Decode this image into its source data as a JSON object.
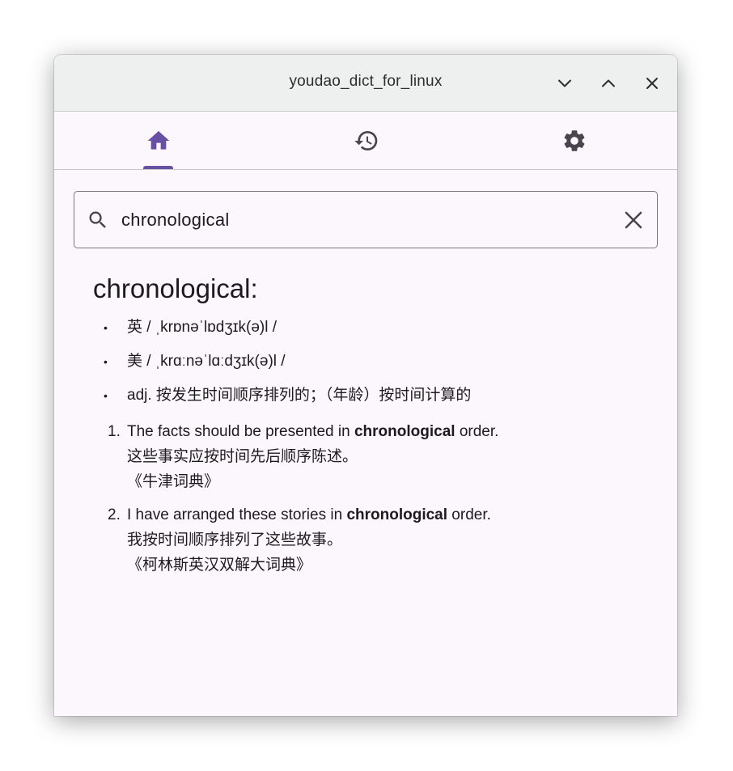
{
  "window": {
    "title": "youdao_dict_for_linux"
  },
  "nav": {
    "tabs": [
      {
        "name": "home",
        "icon": "home-icon",
        "active": true
      },
      {
        "name": "history",
        "icon": "history-icon",
        "active": false
      },
      {
        "name": "settings",
        "icon": "gear-icon",
        "active": false
      }
    ]
  },
  "search": {
    "value": "chronological"
  },
  "result": {
    "title": "chronological:",
    "definitions": [
      "英 / ˌkrɒnəˈlɒdʒɪk(ə)l /",
      "美 / ˌkrɑːnəˈlɑːdʒɪk(ə)l /",
      "adj. 按发生时间顺序排列的；（年龄）按时间计算的"
    ],
    "examples": [
      {
        "num": "1.",
        "before": "The facts should be presented in ",
        "bold": "chronological",
        "after": " order.",
        "translation": "这些事实应按时间先后顺序陈述。",
        "source": "《牛津词典》"
      },
      {
        "num": "2.",
        "before": "I have arranged these stories in ",
        "bold": "chronological",
        "after": " order.",
        "translation": "我按时间顺序排列了这些故事。",
        "source": "《柯林斯英汉双解大词典》"
      }
    ]
  },
  "colors": {
    "accent": "#6750a4",
    "background": "#fcf6fd",
    "titlebar": "#eeefef",
    "text": "#1d1b20",
    "icon": "#49454f"
  }
}
